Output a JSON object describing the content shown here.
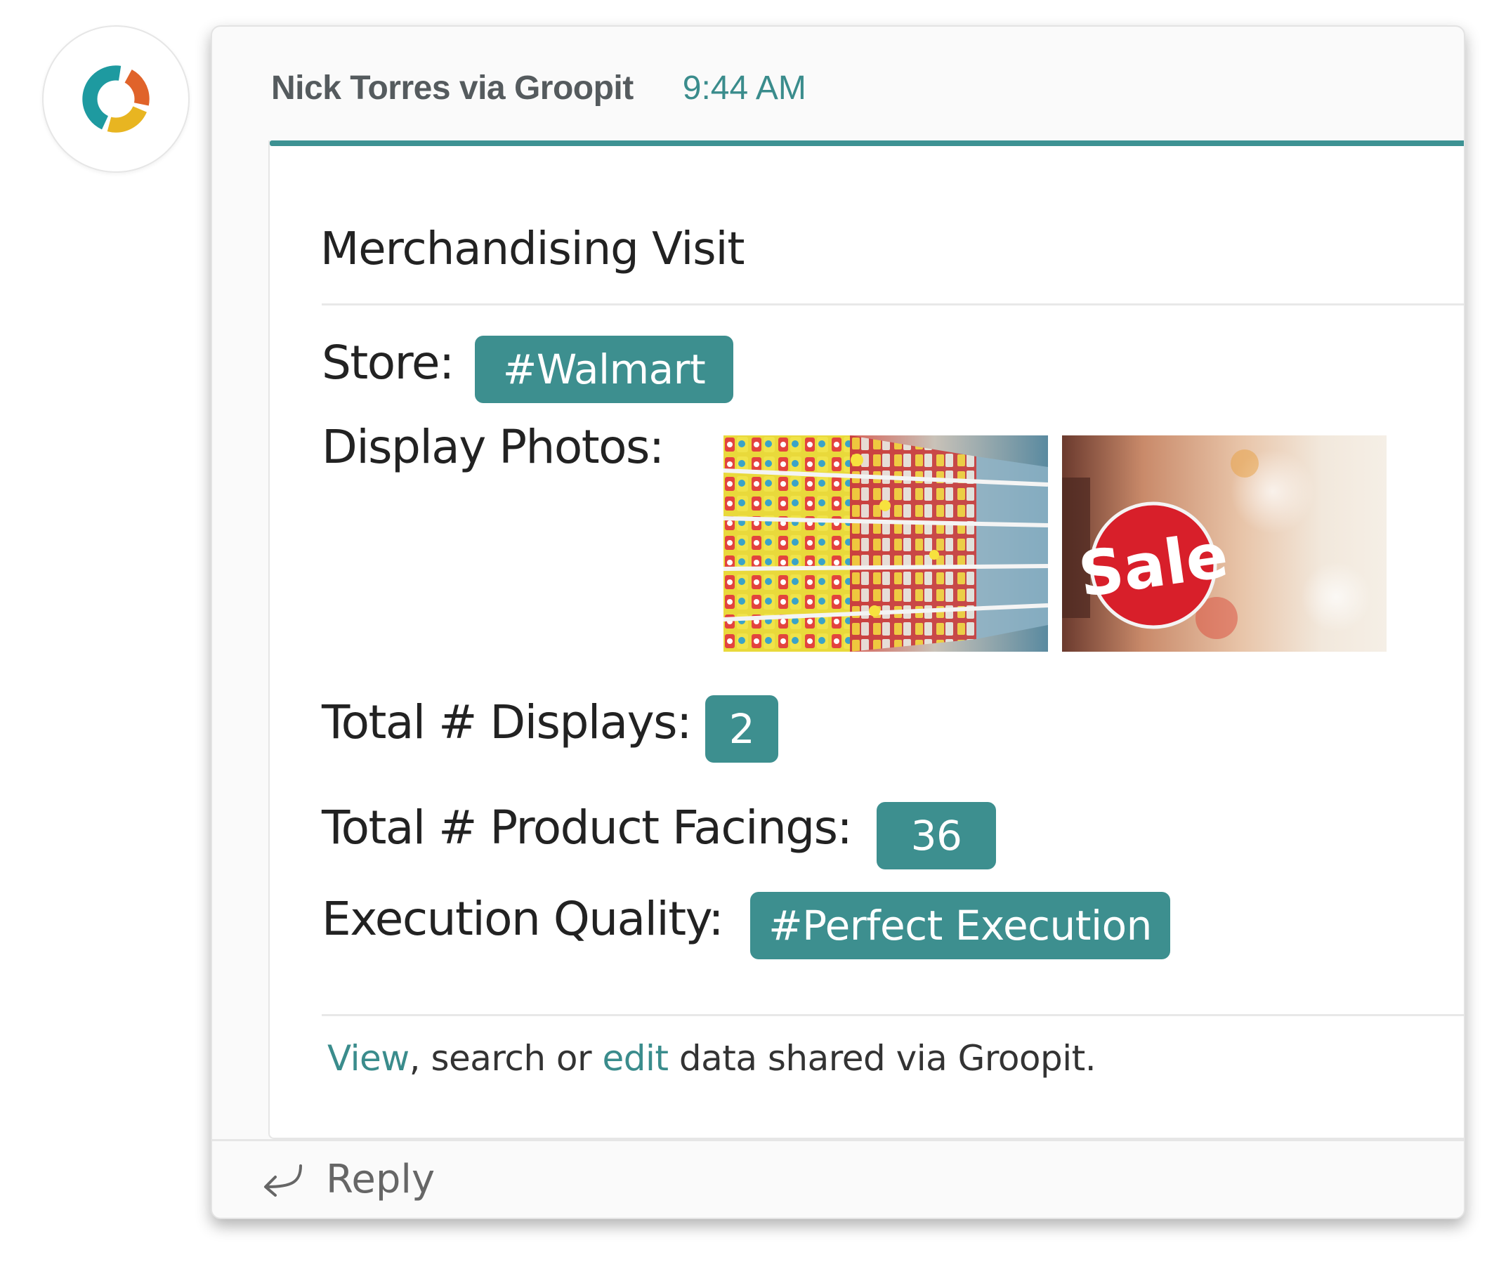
{
  "message": {
    "sender": "Nick Torres via Groopit",
    "time": "9:44 AM"
  },
  "card": {
    "title": "Merchandising Visit",
    "fields": {
      "store": {
        "label": "Store:",
        "value": "#Walmart"
      },
      "display_photos": {
        "label": "Display Photos:"
      },
      "total_displays": {
        "label": "Total # Displays:",
        "value": "2"
      },
      "product_facings": {
        "label": "Total # Product Facings:",
        "value": "36"
      },
      "execution_quality": {
        "label": "Execution Quality:",
        "value": "#Perfect Execution"
      }
    },
    "photos": [
      {
        "name": "store-shelves-photo"
      },
      {
        "name": "sale-sign-photo",
        "sign_text": "Sale"
      }
    ],
    "footer": {
      "view": "View",
      "mid": ", search or ",
      "edit": "edit",
      "rest": " data shared via Groopit."
    }
  },
  "reply": {
    "label": "Reply"
  },
  "icons": [
    "groopit-logo-icon",
    "reply-arrow-icon"
  ],
  "colors": {
    "accent": "#3d8f8f",
    "link": "#3a8c8c",
    "logo_orange": "#e0632a",
    "logo_yellow": "#e8b521",
    "logo_teal": "#1e9aa0"
  }
}
